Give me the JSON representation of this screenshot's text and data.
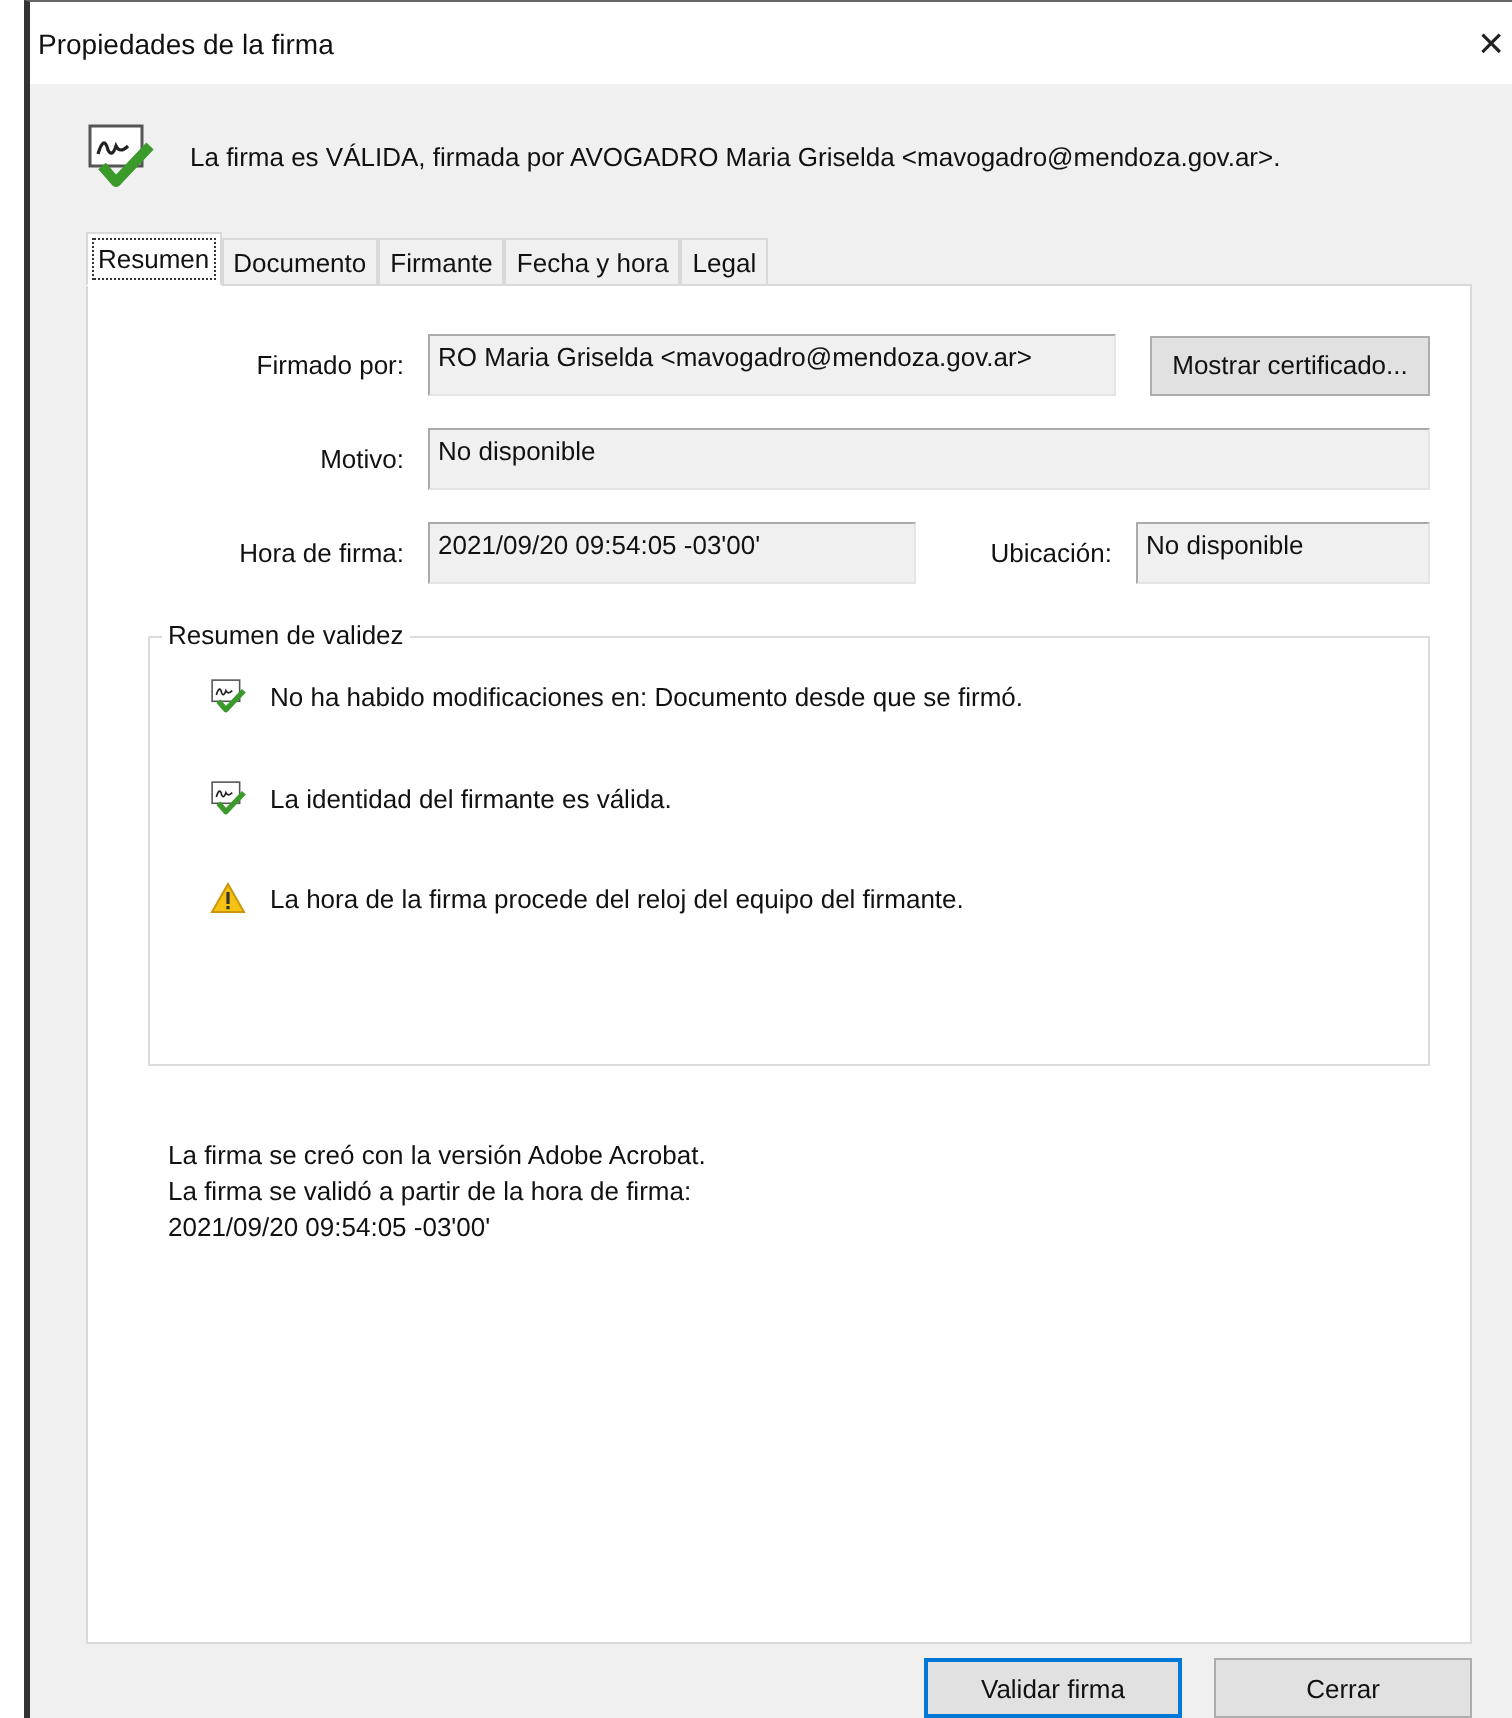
{
  "window": {
    "title": "Propiedades de la firma",
    "close": "×"
  },
  "status": {
    "kind": "valid",
    "text": "La firma es VÁLIDA, firmada por AVOGADRO Maria Griselda <mavogadro@mendoza.gov.ar>."
  },
  "tabs": [
    {
      "label": "Resumen",
      "selected": true
    },
    {
      "label": "Documento",
      "selected": false
    },
    {
      "label": "Firmante",
      "selected": false
    },
    {
      "label": "Fecha y hora",
      "selected": false
    },
    {
      "label": "Legal",
      "selected": false
    }
  ],
  "fields": {
    "signed_by": {
      "label": "Firmado por:",
      "value": "RO Maria Griselda <mavogadro@mendoza.gov.ar>"
    },
    "show_certificate_button": "Mostrar certificado...",
    "reason": {
      "label": "Motivo:",
      "value": "No disponible"
    },
    "signing_time": {
      "label": "Hora de firma:",
      "value": "2021/09/20 09:54:05 -03'00'"
    },
    "location": {
      "label": "Ubicación:",
      "value": "No disponible"
    }
  },
  "validity_summary": {
    "title": "Resumen de validez",
    "items": [
      {
        "kind": "valid",
        "text": "No ha habido modificaciones en: Documento desde que se firmó."
      },
      {
        "kind": "valid",
        "text": "La identidad del firmante es válida."
      },
      {
        "kind": "warning",
        "text": "La hora de la firma procede del reloj del equipo del firmante."
      }
    ]
  },
  "info_lines": [
    "La firma se creó con la versión Adobe Acrobat.",
    "La firma se validó a partir de la hora de firma:",
    "2021/09/20 09:54:05 -03'00'"
  ],
  "buttons": [
    {
      "label": "Validar firma",
      "default": true
    },
    {
      "label": "Cerrar",
      "default": false
    }
  ]
}
